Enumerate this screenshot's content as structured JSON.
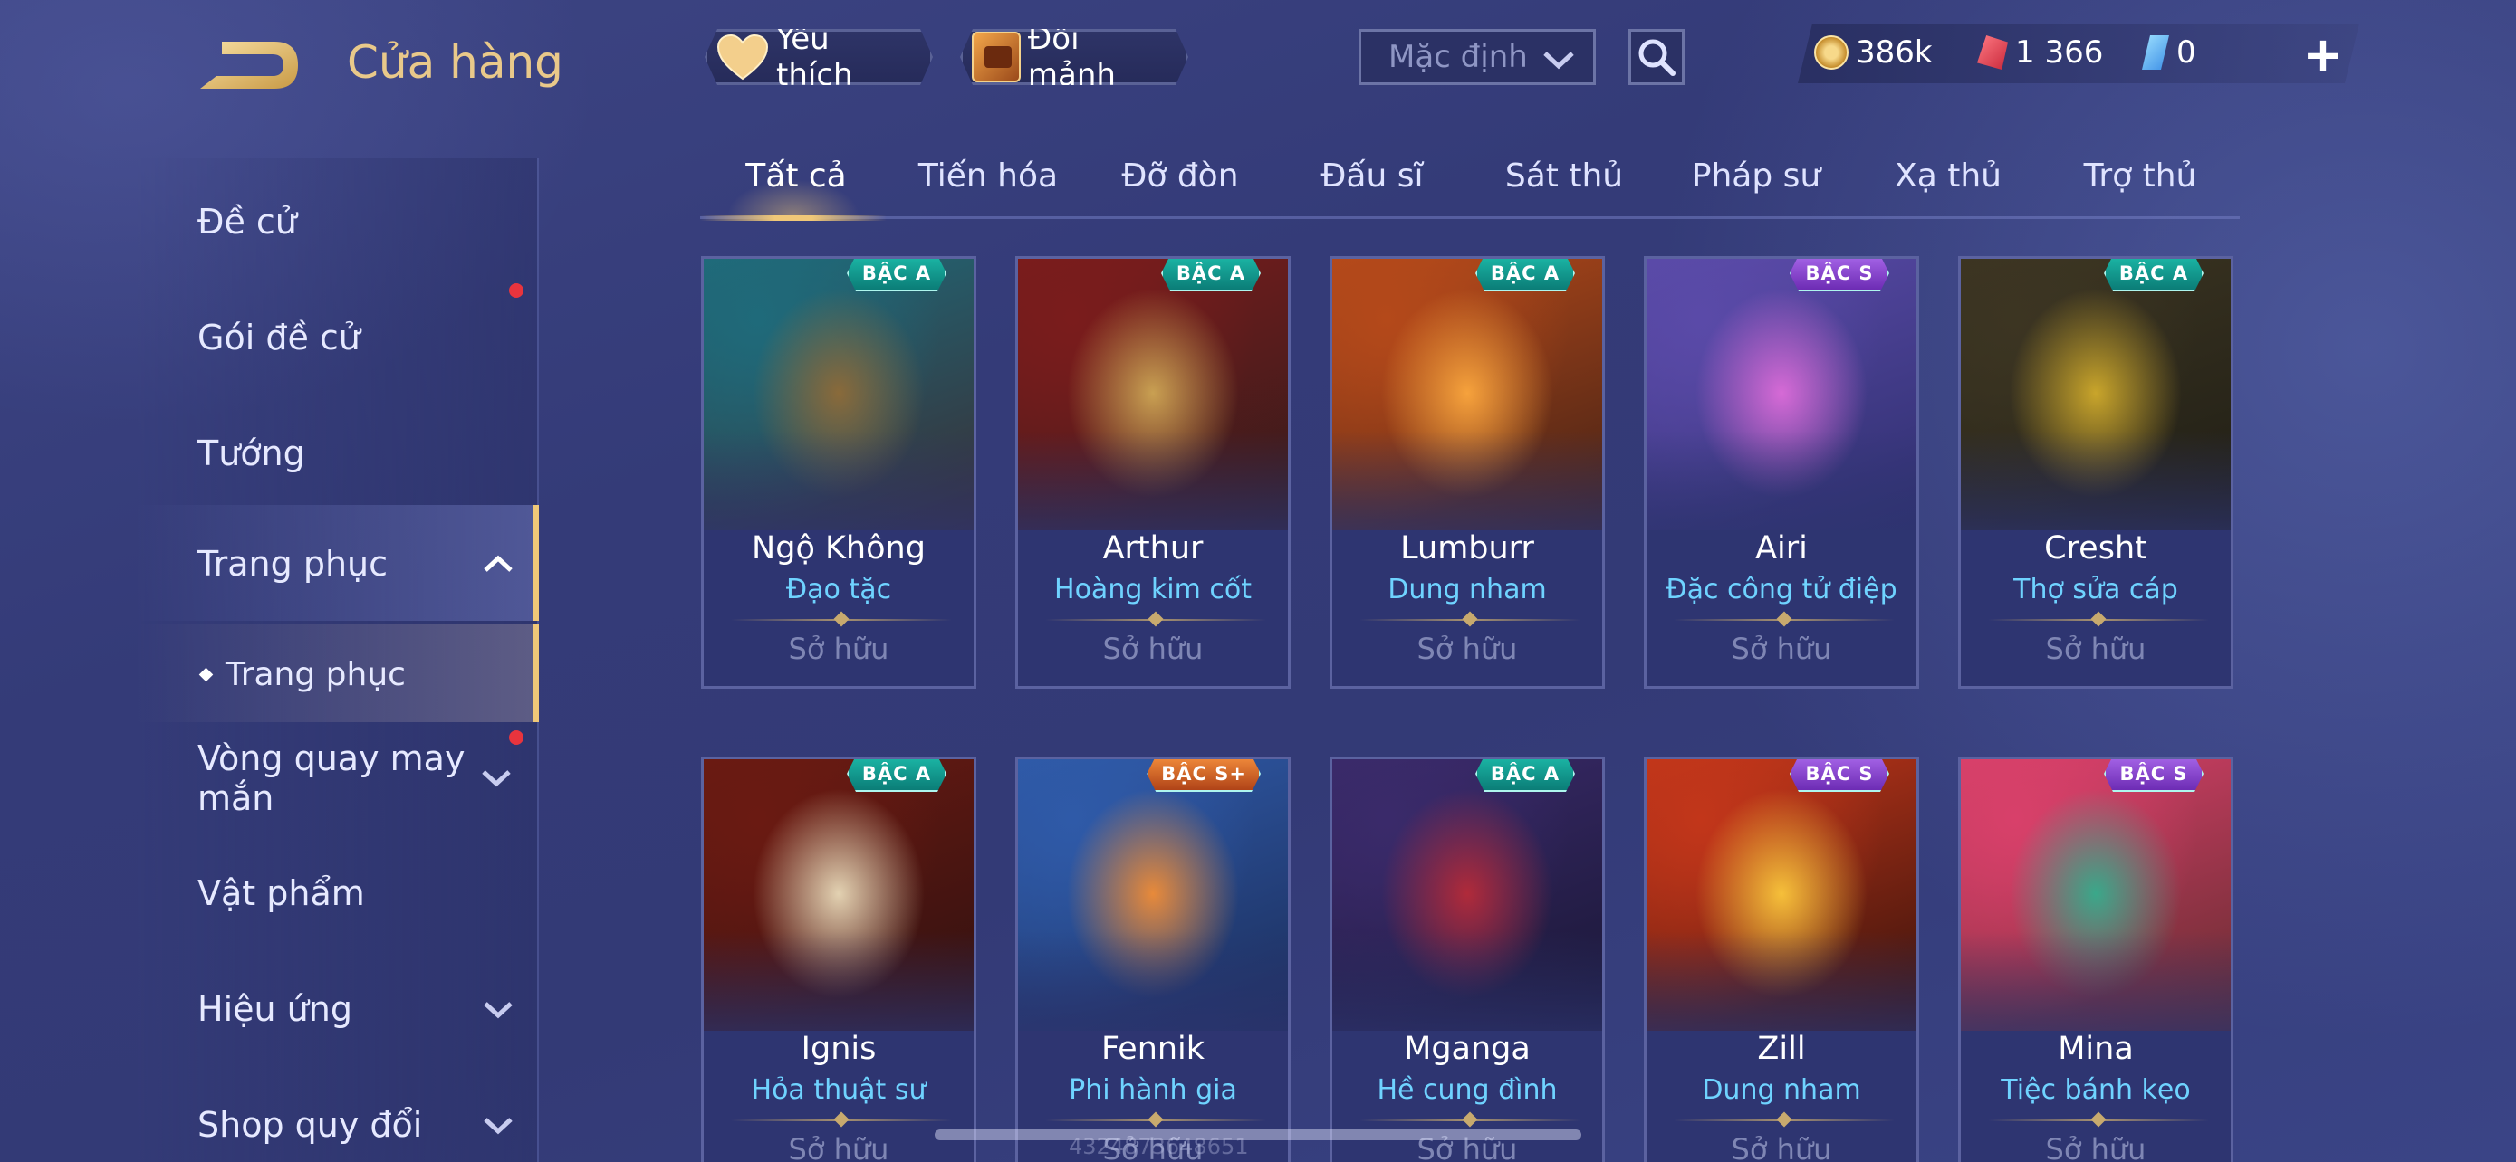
{
  "header": {
    "title": "Cửa hàng",
    "favorites_label": "Yêu thích",
    "shard_exchange_label": "Đổi mảnh",
    "sort": {
      "selected": "Mặc định"
    },
    "currencies": {
      "gold": "386k",
      "voucher": "1 366",
      "ticket": "0"
    },
    "add_label": "+"
  },
  "sidebar": {
    "items": [
      {
        "label": "Đề cử"
      },
      {
        "label": "Gói đề cử",
        "badge": true
      },
      {
        "label": "Tướng"
      },
      {
        "label": "Trang phục",
        "expanded": true,
        "active": true
      },
      {
        "label": "Trang phục",
        "sub": true,
        "active": true
      },
      {
        "label": "Vòng quay may mắn",
        "badge": true
      },
      {
        "label": "Vật phẩm"
      },
      {
        "label": "Hiệu ứng"
      },
      {
        "label": "Shop quy đổi"
      }
    ]
  },
  "tabs": [
    {
      "label": "Tất cả",
      "active": true
    },
    {
      "label": "Tiến hóa"
    },
    {
      "label": "Đỡ đòn"
    },
    {
      "label": "Đấu sĩ"
    },
    {
      "label": "Sát thủ"
    },
    {
      "label": "Pháp sư"
    },
    {
      "label": "Xạ thủ"
    },
    {
      "label": "Trợ thủ"
    }
  ],
  "cards": [
    {
      "hero": "Ngộ Không",
      "skin": "Đạo tặc",
      "tier": "BẬC A",
      "status": "Sở hữu",
      "palette": [
        "#1f6a7a",
        "#8a6a3a",
        "#3b2a30"
      ]
    },
    {
      "hero": "Arthur",
      "skin": "Hoàng kim cốt",
      "tier": "BẬC A",
      "status": "Sở hữu",
      "palette": [
        "#7a1c1c",
        "#c9a052",
        "#2d1b1b"
      ]
    },
    {
      "hero": "Lumburr",
      "skin": "Dung nham",
      "tier": "BẬC A",
      "status": "Sở hữu",
      "palette": [
        "#b4491a",
        "#f6a23c",
        "#3a1e15"
      ]
    },
    {
      "hero": "Airi",
      "skin": "Đặc công tử điệp",
      "tier": "BẬC S",
      "status": "Sở hữu",
      "palette": [
        "#5a4aa8",
        "#d66ad6",
        "#2b2d6a"
      ]
    },
    {
      "hero": "Cresht",
      "skin": "Thợ sửa cáp",
      "tier": "BẬC A",
      "status": "Sở hữu",
      "palette": [
        "#3c3522",
        "#c9a52b",
        "#1d1c14"
      ]
    },
    {
      "hero": "Ignis",
      "skin": "Hỏa thuật sư",
      "tier": "BẬC A",
      "status": "Sở hữu",
      "palette": [
        "#6a1a12",
        "#e3d2b2",
        "#2a1010"
      ]
    },
    {
      "hero": "Fennik",
      "skin": "Phi hành gia",
      "tier": "BẬC S+",
      "status": "Sở hữu",
      "palette": [
        "#2f5aa8",
        "#e88a3a",
        "#1a2a55"
      ]
    },
    {
      "hero": "Mganga",
      "skin": "Hề cung đình",
      "tier": "BẬC A",
      "status": "Sở hữu",
      "palette": [
        "#3a2a6a",
        "#b02a3a",
        "#161530"
      ]
    },
    {
      "hero": "Zill",
      "skin": "Dung nham",
      "tier": "BẬC S",
      "status": "Sở hữu",
      "palette": [
        "#c2361a",
        "#f6c03a",
        "#2a0f0a"
      ]
    },
    {
      "hero": "Mina",
      "skin": "Tiệc bánh kẹo",
      "tier": "BẬC S",
      "status": "Sở hữu",
      "palette": [
        "#d8406a",
        "#3aa88a",
        "#5a2a2a"
      ]
    }
  ],
  "footer": {
    "uid": "4324873648651"
  },
  "colors": {
    "accent_gold": "#f0c878",
    "skin_name_blue": "#6fd3ff",
    "badge_red": "#e8343d"
  }
}
